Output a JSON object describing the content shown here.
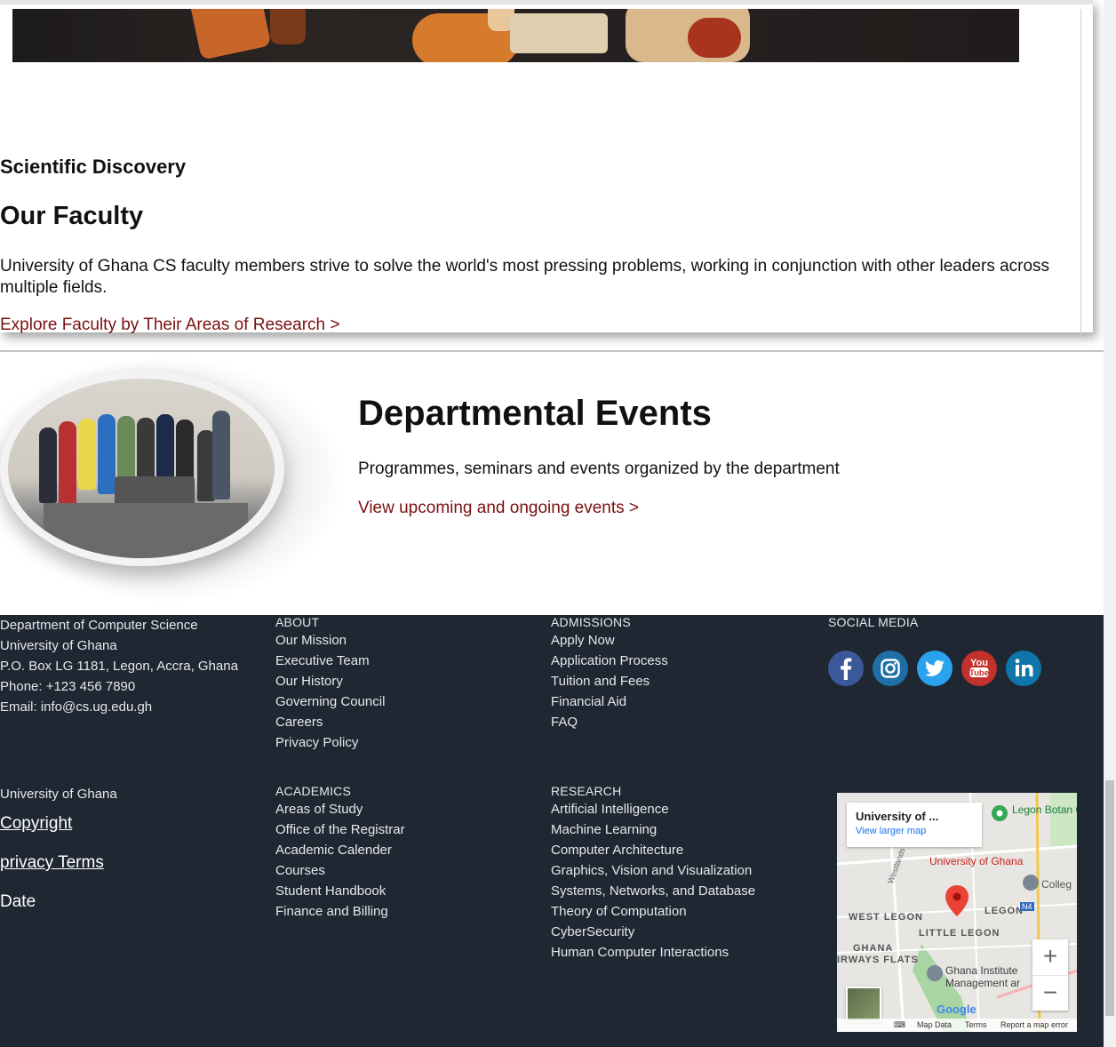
{
  "faculty": {
    "eyebrow": "Scientific Discovery",
    "title": "Our Faculty",
    "text": "University of Ghana CS faculty members strive to solve the world's most pressing problems, working in conjunction with other leaders across multiple fields.",
    "link": "Explore Faculty by Their Areas of Research >"
  },
  "events": {
    "title": "Departmental Events",
    "text": "Programmes, seminars and events organized by the department",
    "link": "View upcoming and ongoing events >"
  },
  "footer": {
    "contact": [
      "Department of Computer Science",
      "University of Ghana",
      "P.O. Box LG 1181, Legon, Accra, Ghana",
      "Phone: +123 456 7890",
      "Email: info@cs.ug.edu.gh"
    ],
    "about": {
      "heading": "ABOUT",
      "items": [
        "Our Mission",
        "Executive Team",
        "Our History",
        "Governing Council",
        "Careers",
        "Privacy Policy"
      ]
    },
    "admissions": {
      "heading": "ADMISSIONS",
      "items": [
        "Apply Now",
        "Application Process",
        "Tuition and Fees",
        "Financial Aid",
        "FAQ"
      ]
    },
    "social": {
      "heading": "SOCIAL MEDIA",
      "icons": [
        "facebook-icon",
        "instagram-icon",
        "twitter-icon",
        "youtube-icon",
        "linkedin-icon"
      ],
      "colors": [
        "#3b5998",
        "#1d6fa5",
        "#2aa3ef",
        "#c4302b",
        "#0e76a8"
      ]
    },
    "university": "University of Ghana",
    "bottom_links": [
      "Copyright",
      "privacy Terms",
      "Date"
    ],
    "academics": {
      "heading": "ACADEMICS",
      "items": [
        "Areas of Study",
        "Office of the Registrar",
        "Academic Calender",
        "Courses",
        "Student Handbook",
        "Finance and Billing"
      ]
    },
    "research": {
      "heading": "RESEARCH",
      "items": [
        "Artificial Intelligence",
        "Machine Learning",
        "Computer Architecture",
        "Graphics, Vision and Visualization",
        "Systems, Networks, and Database",
        "Theory of Computation",
        "CyberSecurity",
        "Human Computer Interactions"
      ]
    }
  },
  "map": {
    "place": "University of ...",
    "view_larger": "View larger map",
    "labels": {
      "botanical": "Legon Botan Gardens Gh",
      "university": "University of Ghana",
      "college": "Colleg",
      "westlands": "Westlands",
      "west_legon": "WEST LEGON",
      "legon": "LEGON",
      "n4": "N4",
      "little_legon": "LITTLE LEGON",
      "ghana": "GHANA",
      "airways": "IRWAYS FLATS",
      "institute": "Ghana Institute Management ar"
    },
    "google": "Google",
    "zoom_in": "+",
    "zoom_out": "−",
    "bottom": [
      "Map Data",
      "Terms",
      "Report a map error"
    ]
  }
}
